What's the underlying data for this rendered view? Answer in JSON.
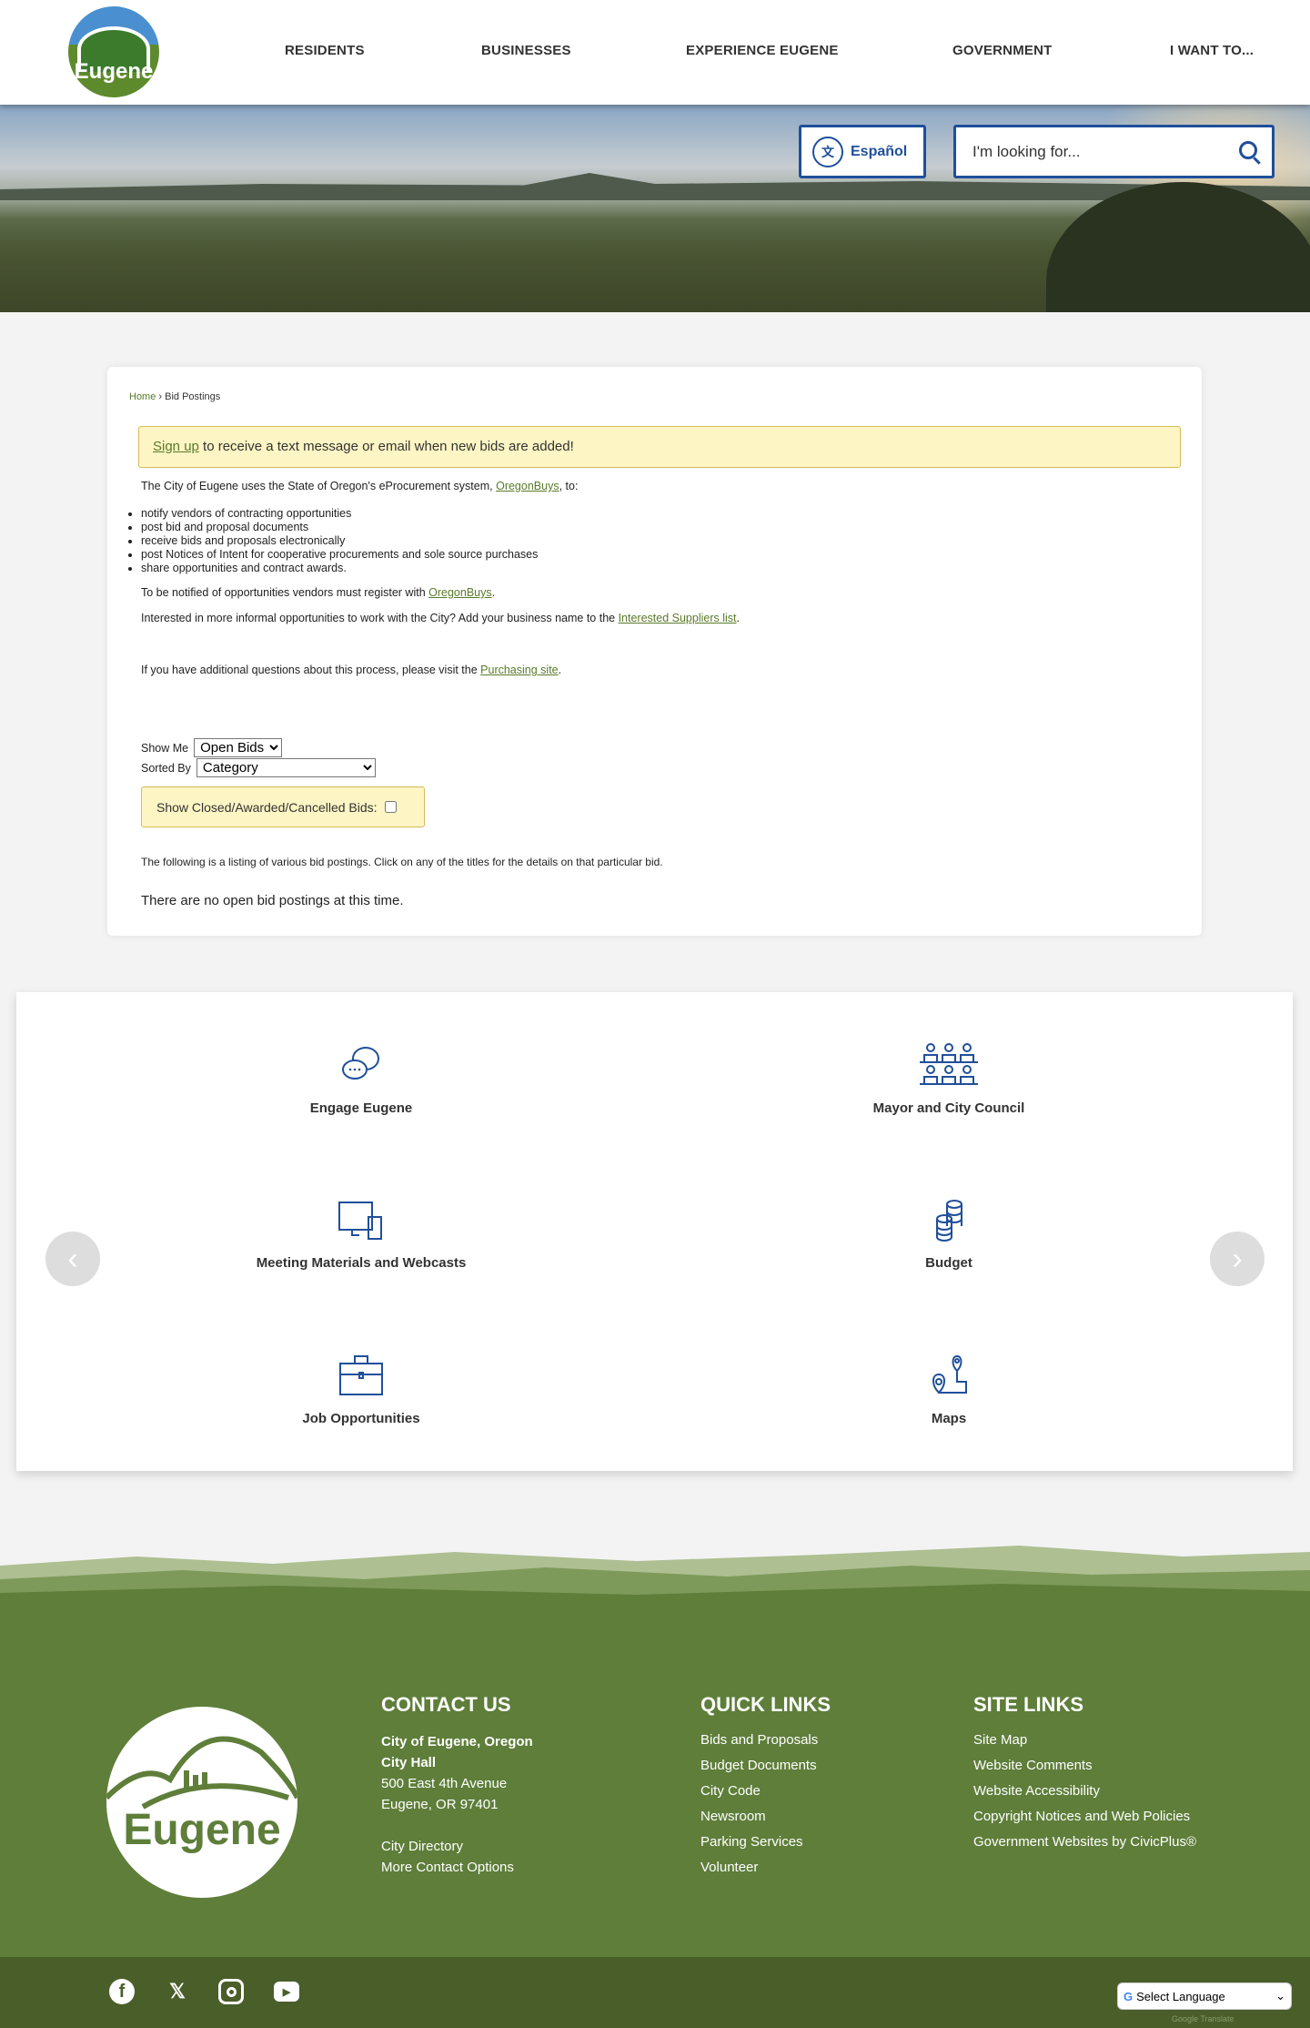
{
  "header": {
    "logo_text": "Eugene",
    "nav": [
      "RESIDENTS",
      "BUSINESSES",
      "EXPERIENCE EUGENE",
      "GOVERNMENT",
      "I WANT TO..."
    ],
    "espanol": "Español",
    "search_placeholder": "I'm looking for..."
  },
  "breadcrumb": {
    "home": "Home",
    "sep": "›",
    "current": "Bid Postings"
  },
  "banner": {
    "link": "Sign up",
    "text": " to receive a text message or email when new bids are added!"
  },
  "intro": {
    "text1": "The City of Eugene uses the State of Oregon's eProcurement system, ",
    "link1": "OregonBuys",
    "text2": ", to:"
  },
  "bullets": [
    "notify vendors of contracting opportunities",
    "post bid and proposal documents",
    "receive bids and proposals electronically",
    "post Notices of Intent for cooperative procurements and sole source purchases",
    "share opportunities and contract awards."
  ],
  "register": {
    "text": "To be notified of opportunities vendors must register with ",
    "link": "OregonBuys",
    "end": "."
  },
  "informal": {
    "text": "Interested in more informal opportunities to work with the City? Add your business name to the ",
    "link": "Interested Suppliers list",
    "end": "."
  },
  "questions": {
    "text": "If you have additional questions about this process, please visit the ",
    "link": "Purchasing site",
    "end": "."
  },
  "filters": {
    "show_me_label": "Show Me",
    "show_me_value": "Open Bids",
    "sorted_by_label": "Sorted By",
    "sorted_by_value": "Category",
    "closed_label": "Show Closed/Awarded/Cancelled Bids:"
  },
  "listing_text": "The following is a listing of various bid postings. Click on any of the titles for the details on that particular bid.",
  "empty_text": "There are no open bid postings at this time.",
  "services": [
    "Engage Eugene",
    "Mayor and City Council",
    "Meeting Materials and Webcasts",
    "Budget",
    "Job Opportunities",
    "Maps"
  ],
  "footer": {
    "logo_text": "Eugene",
    "contact": {
      "title": "CONTACT US",
      "org": "City of Eugene, Oregon",
      "hall": "City Hall",
      "addr1": "500 East 4th Avenue",
      "addr2": "Eugene, OR 97401",
      "links": [
        "City Directory",
        "More Contact Options"
      ]
    },
    "quick": {
      "title": "QUICK LINKS",
      "links": [
        "Bids and Proposals",
        "Budget Documents",
        "City Code",
        "Newsroom",
        "Parking Services",
        "Volunteer"
      ]
    },
    "site": {
      "title": "SITE LINKS",
      "links": [
        "Site Map",
        "Website Comments",
        "Website Accessibility",
        "Copyright Notices and Web Policies",
        "Government Websites by CivicPlus®"
      ]
    },
    "language": "Select Language",
    "powered": "Google Translate"
  },
  "colors": {
    "blue": "#1f4f9a",
    "green": "#5e7e3a",
    "yellow": "#fdf5c4"
  }
}
